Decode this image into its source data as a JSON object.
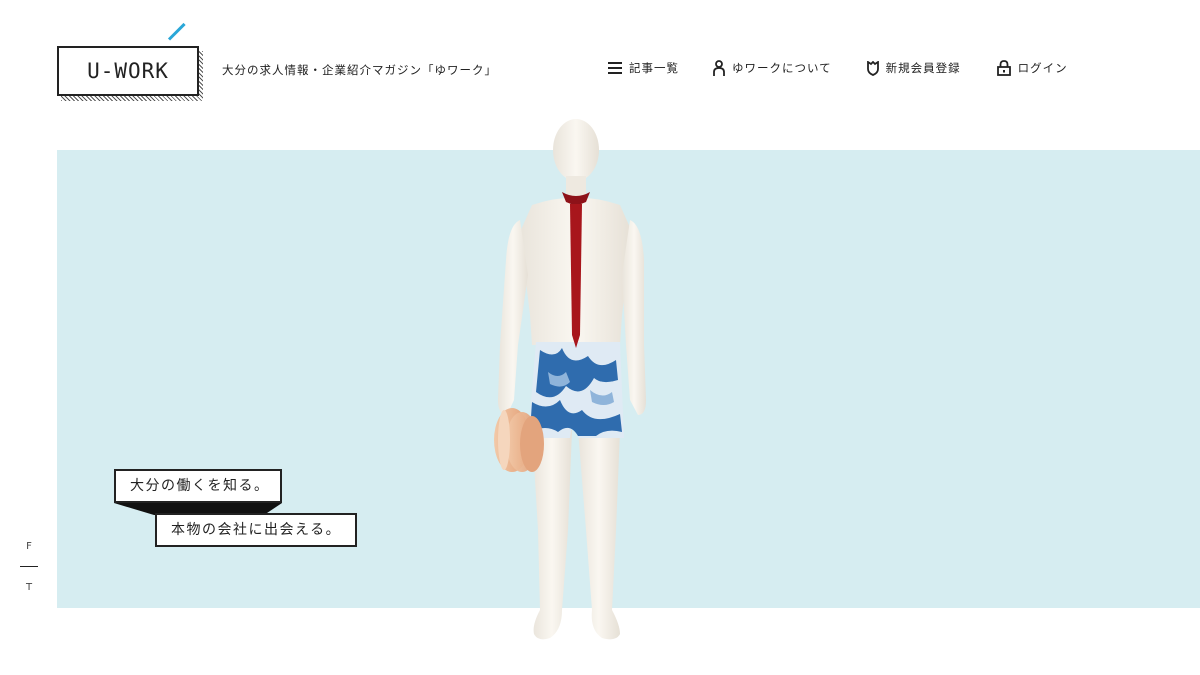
{
  "header": {
    "logo": "U-WORK",
    "tagline": "大分の求人情報・企業紹介マガジン「ゆワーク」",
    "nav": [
      {
        "label": "記事一覧",
        "icon": "list-icon"
      },
      {
        "label": "ゆワークについて",
        "icon": "person-icon"
      },
      {
        "label": "新規会員登録",
        "icon": "shield-icon"
      },
      {
        "label": "ログイン",
        "icon": "lock-icon"
      }
    ]
  },
  "hero": {
    "catch_line_1": "大分の働くを知る。",
    "catch_line_2": "本物の会社に出会える。",
    "background_color": "#d6edf1",
    "figure_icon": "mannequin-figure"
  },
  "share": {
    "facebook": "F",
    "twitter": "T"
  },
  "colors": {
    "accent": "#2aa7d8",
    "text": "#222222",
    "tie": "#a8161c"
  }
}
